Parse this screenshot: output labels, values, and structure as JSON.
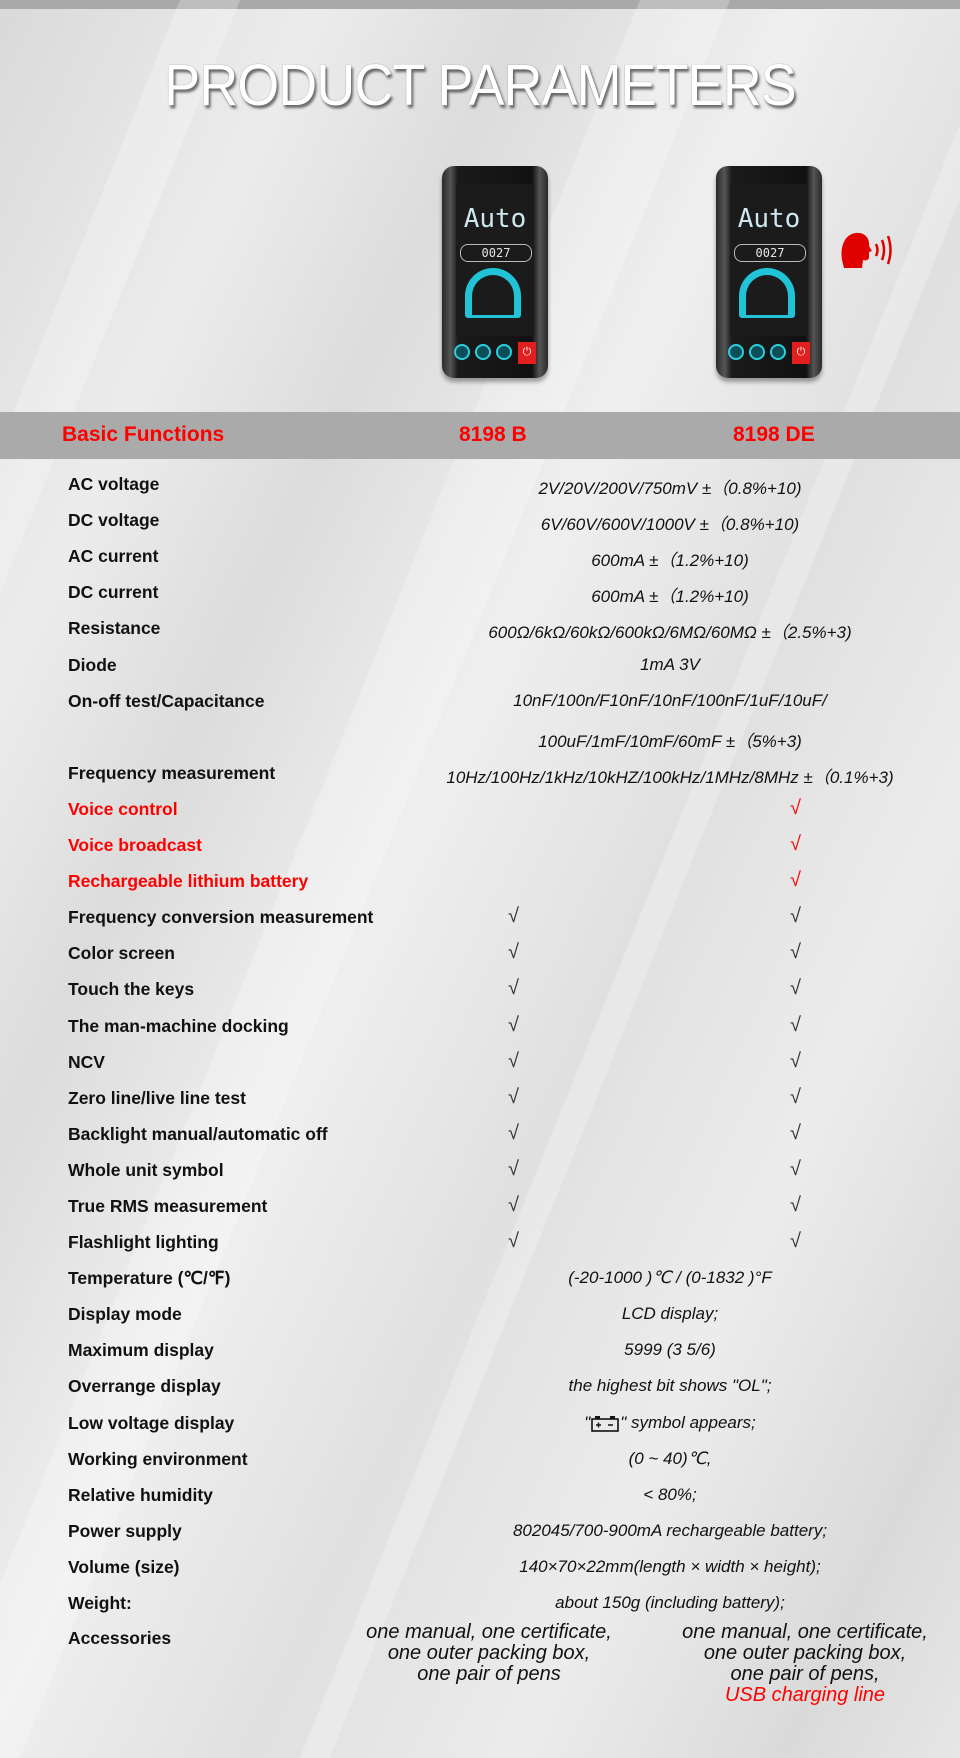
{
  "title": "PRODUCT PARAMETERS",
  "products": [
    {
      "model": "8198 B",
      "screen_text": "Auto",
      "reading": "0027"
    },
    {
      "model": "8198 DE",
      "screen_text": "Auto",
      "reading": "0027",
      "icon": "voice-speaking-icon"
    }
  ],
  "colors": {
    "accent": "#ff0000",
    "header_band": "#aaaaaa",
    "screen_dial": "#21c4d6"
  },
  "header": {
    "col1": "Basic Functions",
    "col2": "8198 B",
    "col3": "8198 DE"
  },
  "spec_rows": [
    {
      "label": "AC voltage",
      "value": "2V/20V/200V/750mV ±（0.8%+10)"
    },
    {
      "label": "DC voltage",
      "value": "6V/60V/600V/1000V ±（0.8%+10)"
    },
    {
      "label": "AC current",
      "value": "600mA  ±（1.2%+10)"
    },
    {
      "label": "DC current",
      "value": "600mA  ±（1.2%+10)"
    },
    {
      "label": "Resistance",
      "value": "600Ω/6kΩ/60kΩ/600kΩ/6MΩ/60MΩ  ±（2.5%+3)"
    },
    {
      "label": "Diode",
      "value": "1mA  3V"
    },
    {
      "label": "On-off test/Capacitance",
      "value": "10nF/100n/F10nF/10nF/100nF/1uF/10uF/"
    },
    {
      "label": "",
      "value": "100uF/1mF/10mF/60mF      ±（5%+3)"
    },
    {
      "label": "Frequency measurement",
      "value": "10Hz/100Hz/1kHz/10kHZ/100kHz/1MHz/8MHz  ±（0.1%+3)"
    }
  ],
  "feature_rows": [
    {
      "label": "Voice control",
      "highlight": true,
      "b": "",
      "de": "√"
    },
    {
      "label": "Voice broadcast",
      "highlight": true,
      "b": "",
      "de": "√"
    },
    {
      "label": "Rechargeable lithium battery",
      "highlight": true,
      "b": "",
      "de": "√"
    },
    {
      "label": "Frequency conversion measurement",
      "highlight": false,
      "b": "√",
      "de": "√"
    },
    {
      "label": "Color screen",
      "highlight": false,
      "b": "√",
      "de": "√"
    },
    {
      "label": "Touch the keys",
      "highlight": false,
      "b": "√",
      "de": "√"
    },
    {
      "label": "The man-machine docking",
      "highlight": false,
      "b": "√",
      "de": "√"
    },
    {
      "label": "NCV",
      "highlight": false,
      "b": "√",
      "de": "√"
    },
    {
      "label": "Zero line/live line test",
      "highlight": false,
      "b": "√",
      "de": "√"
    },
    {
      "label": "Backlight manual/automatic off",
      "highlight": false,
      "b": "√",
      "de": "√"
    },
    {
      "label": "Whole unit symbol",
      "highlight": false,
      "b": "√",
      "de": "√"
    },
    {
      "label": "True RMS measurement",
      "highlight": false,
      "b": "√",
      "de": "√"
    },
    {
      "label": "Flashlight lighting",
      "highlight": false,
      "b": "√",
      "de": "√"
    }
  ],
  "general_rows": [
    {
      "label": "Temperature (℃/℉)",
      "value": "(-20-1000 )℃  /  (0-1832 )°F"
    },
    {
      "label": "Display mode",
      "value": "LCD display;"
    },
    {
      "label": "Maximum display",
      "value": "5999 (3 5/6)"
    },
    {
      "label": "Overrange display",
      "value": "the highest bit shows \"OL\";"
    },
    {
      "label": "Low voltage display",
      "value_prefix": "\"",
      "value_icon": "battery-icon",
      "value_suffix": "\" symbol appears;"
    },
    {
      "label": "Working environment",
      "value": "(0 ~ 40)℃,"
    },
    {
      "label": "Relative humidity",
      "value": "< 80%;"
    },
    {
      "label": "Power supply",
      "value": "802045/700-900mA rechargeable battery;"
    },
    {
      "label": "Volume (size)",
      "value": "140×70×22mm(length × width × height);"
    },
    {
      "label": "Weight:",
      "value": "about 150g (including battery);"
    }
  ],
  "accessories": {
    "label": "Accessories",
    "b": [
      "one manual, one certificate,",
      "one outer packing box,",
      "one pair of pens"
    ],
    "de": [
      "one manual, one certificate,",
      "one outer packing box,",
      "one pair of pens,"
    ],
    "de_extra": "USB charging line"
  }
}
